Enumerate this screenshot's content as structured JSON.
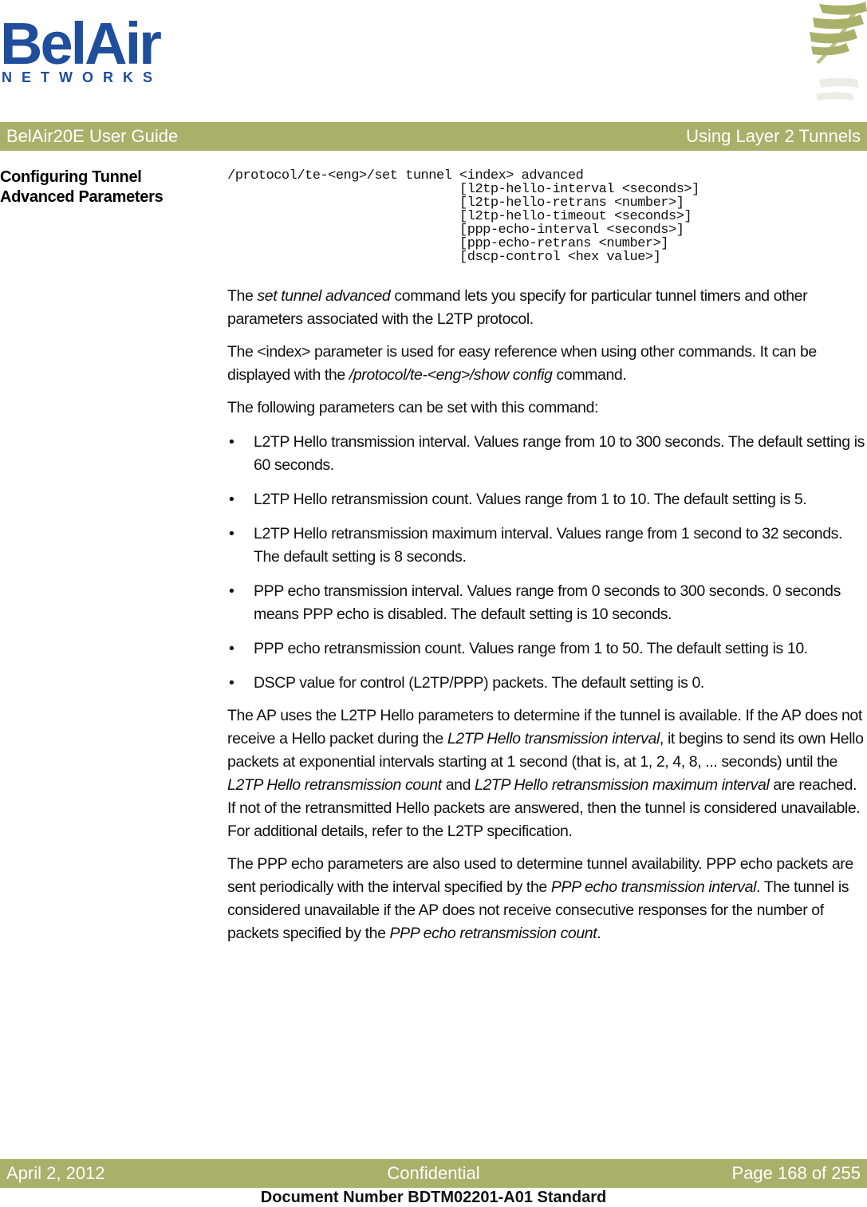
{
  "logo": {
    "main": "BelAir",
    "sub": "NETWORKS"
  },
  "header": {
    "left": "BelAir20E User Guide",
    "right": "Using Layer 2 Tunnels",
    "bar_color": "#a9b06a"
  },
  "section": {
    "heading_line1": "Configuring Tunnel",
    "heading_line2": "Advanced Parameters"
  },
  "command": {
    "lines": [
      "/protocol/te-<eng>/set tunnel <index> advanced",
      "                              [l2tp-hello-interval <seconds>]",
      "                              [l2tp-hello-retrans <number>]",
      "                              [l2tp-hello-timeout <seconds>]",
      "                              [ppp-echo-interval <seconds>]",
      "                              [ppp-echo-retrans <number>]",
      "                              [dscp-control <hex value>]"
    ]
  },
  "paragraphs": {
    "p1": {
      "a": "The ",
      "b_italic": "set tunnel advanced",
      "c": " command lets you specify for particular tunnel timers and other parameters associated with the L2TP protocol."
    },
    "p2": {
      "a": "The <index> parameter is used for easy reference when using other commands. It can be displayed with the ",
      "b_italic": "/protocol/te-<eng>/show config",
      "c": " command."
    },
    "p3": "The following parameters can be set with this command:",
    "p4": {
      "a": "The AP uses the L2TP Hello parameters to determine if the tunnel is available. If the AP does not receive a Hello packet during the ",
      "b_italic": "L2TP Hello transmission interval",
      "c": ", it begins to send its own Hello packets at exponential intervals starting at 1 second (that is, at 1, 2, 4, 8, ... seconds) until the ",
      "d_italic": "L2TP Hello retransmission count",
      "e": " and ",
      "f_italic": "L2TP Hello retransmission maximum interval",
      "g": " are reached. If not of the retransmitted Hello packets are answered, then the tunnel is considered unavailable. For additional details, refer to the L2TP specification."
    },
    "p5": {
      "a": "The PPP echo parameters are also used to determine tunnel availability. PPP echo packets are sent periodically with the interval specified by the ",
      "b_italic": "PPP echo transmission interval",
      "c": ". The tunnel is considered unavailable if the AP does not receive consecutive responses for the number of packets specified by the ",
      "d_italic": "PPP echo retransmission count",
      "e": "."
    }
  },
  "bullets": [
    "L2TP Hello transmission interval. Values range from 10 to 300 seconds. The default setting is 60 seconds.",
    "L2TP Hello retransmission count. Values range from 1 to 10. The default setting is 5.",
    "L2TP Hello retransmission maximum interval. Values range from 1 second to 32 seconds. The default setting is 8 seconds.",
    "PPP echo transmission interval. Values range from 0 seconds to 300 seconds. 0 seconds means PPP echo is disabled. The default setting is 10 seconds.",
    "PPP echo retransmission count. Values range from 1 to 50. The default setting is 10.",
    "DSCP value for control (L2TP/PPP) packets. The default setting is 0."
  ],
  "bullet_glyph": "•",
  "footer": {
    "date": "April 2, 2012",
    "classification": "Confidential",
    "page": "Page 168 of 255",
    "document_number": "Document Number BDTM02201-A01 Standard"
  }
}
